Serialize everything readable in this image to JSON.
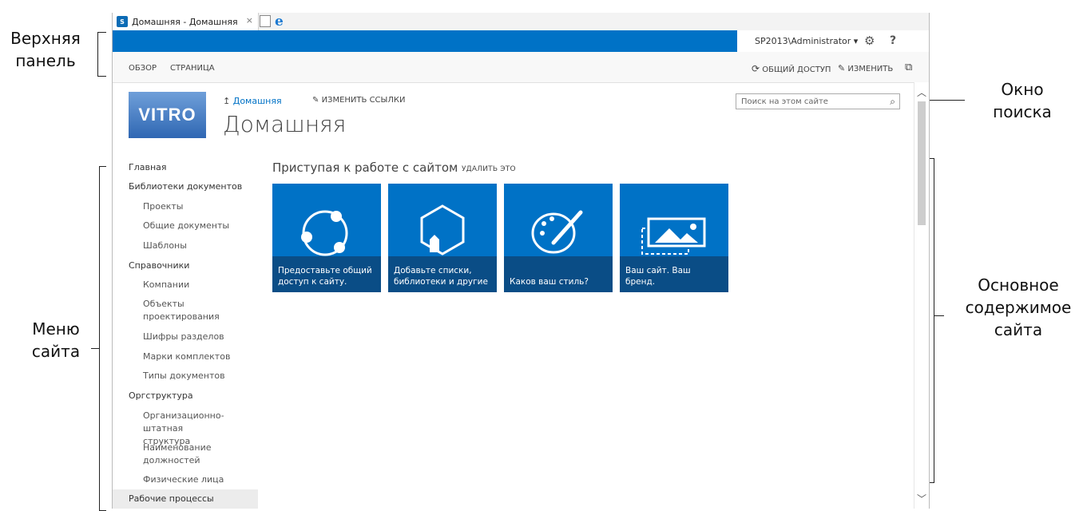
{
  "annotations": {
    "top_bar": [
      "Верхняя",
      "панель"
    ],
    "search_box": [
      "Окно",
      "поиска"
    ],
    "site_menu": [
      "Меню",
      "сайта"
    ],
    "main_content": [
      "Основное",
      "содержимое",
      "сайта"
    ]
  },
  "browser": {
    "tab_title": "Домашняя - Домашняя",
    "tab_close": "×",
    "app_icon": "S"
  },
  "suite_bar": {
    "user": "SP2013\\Administrator ▾",
    "help": "?"
  },
  "ribbon": {
    "tabs": [
      "ОБЗОР",
      "СТРАНИЦА"
    ],
    "share": "ОБЩИЙ ДОСТУП",
    "edit": "ИЗМЕНИТЬ"
  },
  "header": {
    "logo_text": "VITRO",
    "breadcrumb_home": "Домашняя",
    "edit_links": "ИЗМЕНИТЬ ССЫЛКИ",
    "page_title": "Домашняя"
  },
  "search": {
    "placeholder": "Поиск на этом сайте"
  },
  "nav": {
    "items": [
      {
        "label": "Главная"
      },
      {
        "label": "Библиотеки документов"
      },
      {
        "label": "Проекты"
      },
      {
        "label": "Общие документы"
      },
      {
        "label": "Шаблоны"
      },
      {
        "label": "Справочники"
      },
      {
        "label": "Компании"
      },
      {
        "label": "Объекты проектирования"
      },
      {
        "label": "Шифры разделов"
      },
      {
        "label": "Марки комплектов"
      },
      {
        "label": "Типы документов"
      },
      {
        "label": "Оргструктура"
      },
      {
        "label": "Организационно-штатная структура"
      },
      {
        "label": "Наименование должностей"
      },
      {
        "label": "Физические лица"
      },
      {
        "label": "Рабочие процессы"
      }
    ]
  },
  "getting_started": {
    "title": "Приступая к работе с сайтом",
    "remove": "УДАЛИТЬ ЭТО",
    "tiles": [
      {
        "caption": "Предоставьте общий доступ к сайту.",
        "icon": "share-icon"
      },
      {
        "caption": "Добавьте списки, библиотеки и другие",
        "icon": "add-apps-icon"
      },
      {
        "caption": "Каков ваш стиль?",
        "icon": "palette-icon"
      },
      {
        "caption": "Ваш сайт. Ваш бренд.",
        "icon": "picture-icon"
      }
    ]
  },
  "colors": {
    "accent": "#0072c6",
    "tile_caption": "#0a4d86"
  }
}
